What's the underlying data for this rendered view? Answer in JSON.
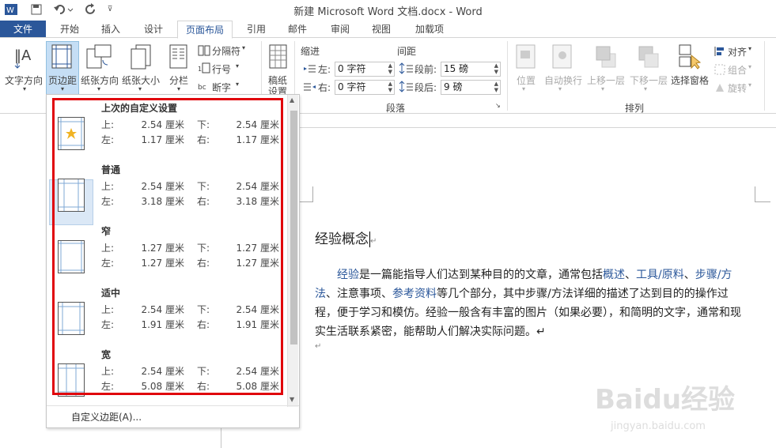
{
  "window": {
    "title": "新建 Microsoft Word 文档.docx - Word"
  },
  "tabs": [
    {
      "label": "文件"
    },
    {
      "label": "开始"
    },
    {
      "label": "插入"
    },
    {
      "label": "设计"
    },
    {
      "label": "页面布局"
    },
    {
      "label": "引用"
    },
    {
      "label": "邮件"
    },
    {
      "label": "审阅"
    },
    {
      "label": "视图"
    },
    {
      "label": "加载项"
    }
  ],
  "ribbon": {
    "text_direction": "文字方向",
    "margins": "页边距",
    "orientation": "纸张方向",
    "size": "纸张大小",
    "columns": "分栏",
    "breaks": "分隔符",
    "line_numbers": "行号",
    "hyphenation": "断字",
    "manuscript": "稿纸\n设置",
    "manuscript_line1": "稿纸",
    "manuscript_line2": "设置",
    "indent_label": "缩进",
    "spacing_label": "间距",
    "indent_left_label": "左:",
    "indent_right_label": "右:",
    "indent_left_value": "0 字符",
    "indent_right_value": "0 字符",
    "spacing_before_label": "段前:",
    "spacing_after_label": "段后:",
    "spacing_before_value": "15 磅",
    "spacing_after_value": "9 磅",
    "paragraph_group": "段落",
    "position": "位置",
    "wrap_text": "自动换行",
    "bring_forward": "上移一层",
    "send_backward": "下移一层",
    "selection_pane": "选择窗格",
    "align": "对齐",
    "group": "组合",
    "rotate": "旋转",
    "arrange_group": "排列"
  },
  "margins_menu": {
    "options": [
      {
        "name": "上次的自定义设置",
        "top": "2.54 厘米",
        "bottom": "2.54 厘米",
        "left": "1.17 厘米",
        "right": "1.17 厘米"
      },
      {
        "name": "普通",
        "top": "2.54 厘米",
        "bottom": "2.54 厘米",
        "left": "3.18 厘米",
        "right": "3.18 厘米"
      },
      {
        "name": "窄",
        "top": "1.27 厘米",
        "bottom": "1.27 厘米",
        "left": "1.27 厘米",
        "right": "1.27 厘米"
      },
      {
        "name": "适中",
        "top": "2.54 厘米",
        "bottom": "2.54 厘米",
        "left": "1.91 厘米",
        "right": "1.91 厘米"
      },
      {
        "name": "宽",
        "top": "2.54 厘米",
        "bottom": "2.54 厘米",
        "left": "5.08 厘米",
        "right": "5.08 厘米"
      }
    ],
    "labels": {
      "top": "上:",
      "bottom": "下:",
      "left": "左:",
      "right": "右:"
    },
    "custom": "自定义边距(A)..."
  },
  "document": {
    "heading": "经验概念",
    "body": [
      {
        "text": "经验",
        "link": true
      },
      {
        "text": "是一篇能指导人们达到某种目的的文章，通常包括",
        "link": false
      },
      {
        "text": "概述",
        "link": true
      },
      {
        "text": "、",
        "link": false
      },
      {
        "text": "工具/原料",
        "link": true
      },
      {
        "text": "、",
        "link": false
      },
      {
        "text": "步骤/方法",
        "link": true
      },
      {
        "text": "、注意事项、",
        "link": false
      },
      {
        "text": "参考资料",
        "link": true
      },
      {
        "text": "等几个部分，其中步骤/方法详细的描述了达到目的的操作过程，便于学习和模仿。经验一般含有丰富的图片（如果必要），和简明的文字，通常和现实生活联系紧密，能帮助人们解决实际问题。↵",
        "link": false
      }
    ],
    "para_mark": "↵"
  },
  "watermark": {
    "text": "Baidu经验",
    "sub": "jingyan.baidu.com"
  },
  "colors": {
    "accent": "#2b579a",
    "highlight_box": "#e0040b"
  }
}
